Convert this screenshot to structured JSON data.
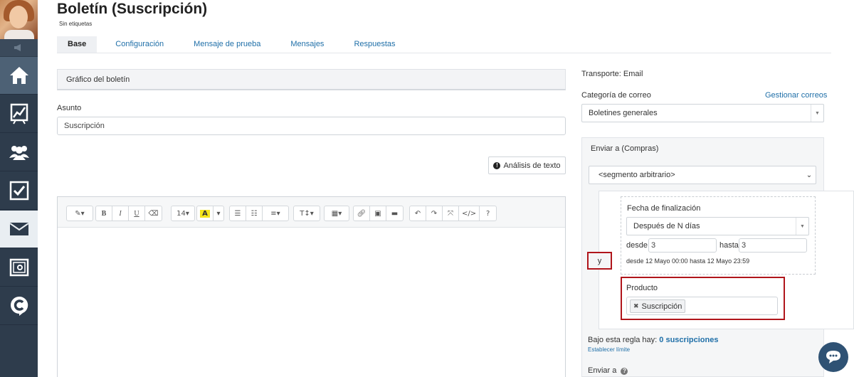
{
  "header": {
    "title": "Boletín (Suscripción)",
    "subtitle": "Sin etiquetas"
  },
  "tabs": [
    {
      "label": "Base",
      "active": true
    },
    {
      "label": "Configuración",
      "active": false
    },
    {
      "label": "Mensaje de prueba",
      "active": false
    },
    {
      "label": "Mensajes",
      "active": false
    },
    {
      "label": "Respuestas",
      "active": false
    }
  ],
  "sidebar": {
    "items": [
      {
        "icon": "home-icon"
      },
      {
        "icon": "chart-icon"
      },
      {
        "icon": "users-icon"
      },
      {
        "icon": "checkbox-icon"
      },
      {
        "icon": "mail-icon",
        "active": true
      },
      {
        "icon": "safe-icon"
      },
      {
        "icon": "c-logo-icon"
      }
    ]
  },
  "main": {
    "panel_title": "Gráfico del boletín",
    "subject_label": "Asunto",
    "subject_value": "Suscripción",
    "analysis_button": "Análisis de texto",
    "editor": {
      "font_size": "14",
      "buttons": [
        "B",
        "I",
        "U"
      ]
    }
  },
  "right": {
    "transport": "Transporte: Email",
    "mail_category_label": "Categoría de correo",
    "manage_mail_link": "Gestionar correos",
    "mail_category_value": "Boletines generales",
    "send_to_header": "Enviar a (Compras)",
    "segment_value": "<segmento arbitrario>",
    "conjunction": "y",
    "end_date_label": "Fecha de finalización",
    "end_date_mode": "Después de N días",
    "from_label": "desde",
    "from_value": "3",
    "to_label": "hasta",
    "to_value": "3",
    "range_note": "desde 12 Mayo 00:00 hasta 12 Mayo 23:59",
    "product_label": "Producto",
    "product_tag": "Suscripción",
    "rule_text": "Bajo esta regla hay:",
    "rule_count": "0 suscripciones",
    "set_limit_link": "Establecer límite",
    "send_to_label": "Enviar a"
  },
  "colors": {
    "sidebar": "#2e3c4c",
    "link": "#1f6fa8",
    "highlight": "#b0151b"
  }
}
